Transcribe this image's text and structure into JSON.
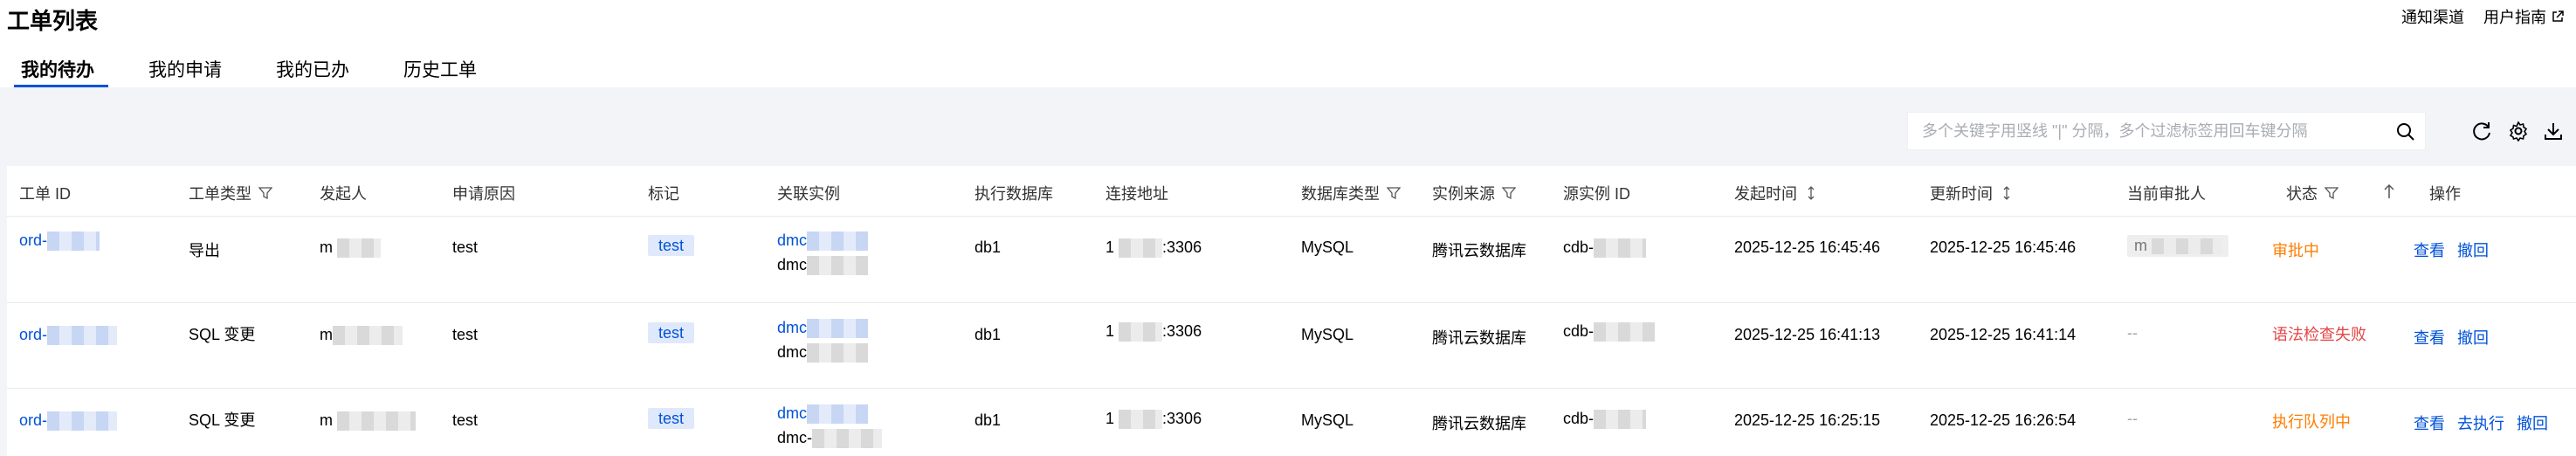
{
  "page": {
    "title": "工单列表",
    "header_links": [
      "通知渠道",
      "用户指南"
    ]
  },
  "tabs": [
    {
      "label": "我的待办",
      "active": true
    },
    {
      "label": "我的申请",
      "active": false
    },
    {
      "label": "我的已办",
      "active": false
    },
    {
      "label": "历史工单",
      "active": false
    }
  ],
  "search": {
    "placeholder": "多个关键字用竖线 \"|\" 分隔，多个过滤标签用回车键分隔",
    "value": ""
  },
  "toolbar_icons": [
    "search-icon",
    "refresh-icon",
    "settings-icon",
    "download-icon"
  ],
  "table": {
    "columns": [
      "工单 ID",
      "工单类型",
      "发起人",
      "申请原因",
      "标记",
      "关联实例",
      "执行数据库",
      "连接地址",
      "数据库类型",
      "实例来源",
      "源实例 ID",
      "发起时间",
      "更新时间",
      "当前审批人",
      "状态",
      "操作"
    ],
    "rows": [
      {
        "id": "ord-",
        "type": "导出",
        "initiator": "m",
        "reason": "test",
        "tag": "test",
        "instance_1": "dmc",
        "instance_2": "dmc",
        "database": "db1",
        "address_prefix": "1",
        "address_suffix": ":3306",
        "db_type": "MySQL",
        "source": "腾讯云数据库",
        "source_id": "cdb-",
        "created": "2025-12-25 16:45:46",
        "updated": "2025-12-25 16:45:46",
        "approver": "m",
        "status": "审批中",
        "status_color": "#ff7d00",
        "actions": [
          "查看",
          "撤回"
        ]
      },
      {
        "id": "ord-",
        "type": "SQL 变更",
        "initiator": "m",
        "reason": "test",
        "tag": "test",
        "instance_1": "dmc",
        "instance_2": "dmc",
        "database": "db1",
        "address_prefix": "1",
        "address_suffix": ":3306",
        "db_type": "MySQL",
        "source": "腾讯云数据库",
        "source_id": "cdb-",
        "created": "2025-12-25 16:41:13",
        "updated": "2025-12-25 16:41:14",
        "approver": "--",
        "status": "语法检查失败",
        "status_color": "#e54545",
        "actions": [
          "查看",
          "撤回"
        ]
      },
      {
        "id": "ord-",
        "type": "SQL 变更",
        "initiator": "m",
        "reason": "test",
        "tag": "test",
        "instance_1": "dmc",
        "instance_2": "dmc-",
        "database": "db1",
        "address_prefix": "1",
        "address_suffix": ":3306",
        "db_type": "MySQL",
        "source": "腾讯云数据库",
        "source_id": "cdb-",
        "created": "2025-12-25 16:25:15",
        "updated": "2025-12-25 16:26:54",
        "approver": "--",
        "status": "执行队列中",
        "status_color": "#ff7d00",
        "actions": [
          "查看",
          "去执行",
          "撤回"
        ]
      }
    ]
  },
  "colors": {
    "accent": "#0052d9",
    "tag_bg": "#dfe9fb",
    "page_bg": "#f2f4f8"
  }
}
